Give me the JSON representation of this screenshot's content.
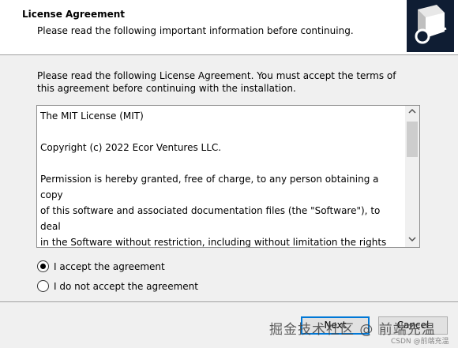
{
  "header": {
    "title": "License Agreement",
    "subtitle": "Please read the following important information before continuing."
  },
  "intro": "Please read the following License Agreement. You must accept the terms of this agreement before continuing with the installation.",
  "license": {
    "text": "The MIT License (MIT)\n\nCopyright (c) 2022 Ecor Ventures LLC.\n\nPermission is hereby granted, free of charge, to any person obtaining a copy\nof this software and associated documentation files (the \"Software\"), to deal\nin the Software without restriction, including without limitation the rights\nto use, copy, modify, merge, publish, distribute, sublicense, and/or sell\ncopies of the Software, and to permit persons to whom the Software is"
  },
  "options": {
    "accept": "I accept the agreement",
    "decline": "I do not accept the agreement",
    "selected": "accept"
  },
  "buttons": {
    "next": "Next",
    "cancel": "Cancel"
  },
  "watermark": {
    "main": "掘金技术社区 @ 前端充温",
    "small": "CSDN @前端充温"
  },
  "icons": {
    "scroll_up": "chevron-up-icon",
    "scroll_down": "chevron-down-icon",
    "logo": "installer-logo-icon"
  }
}
